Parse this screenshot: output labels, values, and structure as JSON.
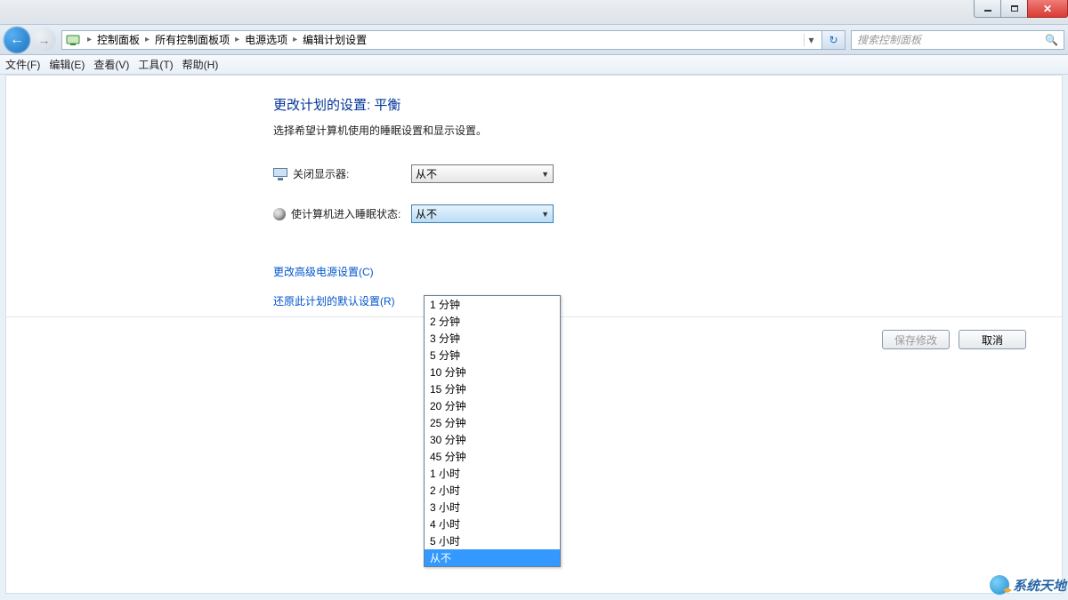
{
  "window": {
    "controls": {
      "min": "minimize",
      "max": "maximize",
      "close": "close"
    }
  },
  "breadcrumb": {
    "items": [
      "控制面板",
      "所有控制面板项",
      "电源选项",
      "编辑计划设置"
    ]
  },
  "search": {
    "placeholder": "搜索控制面板"
  },
  "menu": {
    "file": "文件(F)",
    "edit": "编辑(E)",
    "view": "查看(V)",
    "tools": "工具(T)",
    "help": "帮助(H)"
  },
  "page": {
    "title": "更改计划的设置: 平衡",
    "description": "选择希望计算机使用的睡眠设置和显示设置。"
  },
  "settings": {
    "turn_off_display": {
      "label": "关闭显示器:",
      "value": "从不"
    },
    "sleep": {
      "label": "使计算机进入睡眠状态:",
      "value": "从不"
    }
  },
  "dropdown_options": [
    "1 分钟",
    "2 分钟",
    "3 分钟",
    "5 分钟",
    "10 分钟",
    "15 分钟",
    "20 分钟",
    "25 分钟",
    "30 分钟",
    "45 分钟",
    "1 小时",
    "2 小时",
    "3 小时",
    "4 小时",
    "5 小时",
    "从不"
  ],
  "dropdown_selected": "从不",
  "links": {
    "advanced": "更改高级电源设置(C)",
    "restore": "还原此计划的默认设置(R)"
  },
  "buttons": {
    "save": "保存修改",
    "cancel": "取消"
  },
  "watermark": "系统天地"
}
